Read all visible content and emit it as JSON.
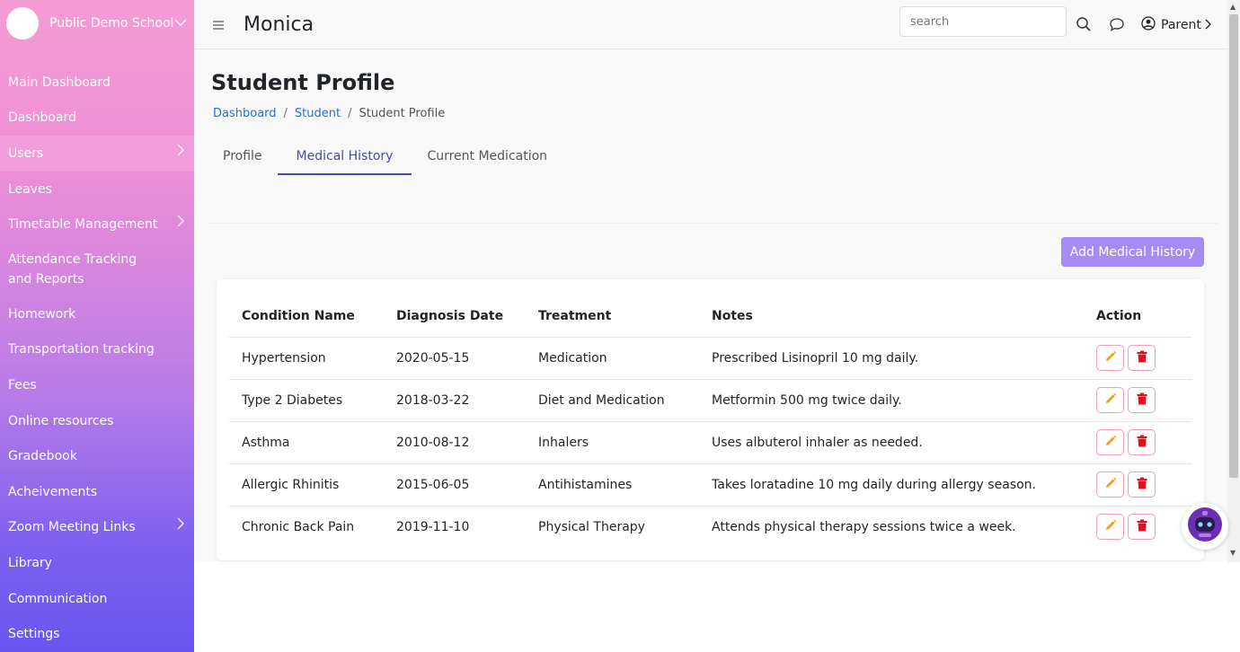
{
  "sidebar": {
    "school": "Public Demo School",
    "items": [
      {
        "label": "Main Dashboard"
      },
      {
        "label": "Dashboard"
      },
      {
        "label": "Users"
      },
      {
        "label": "Leaves"
      },
      {
        "label": "Timetable Management"
      },
      {
        "label": "Attendance Tracking and Reports"
      },
      {
        "label": "Homework"
      },
      {
        "label": "Transportation tracking"
      },
      {
        "label": "Fees"
      },
      {
        "label": "Online resources"
      },
      {
        "label": "Gradebook"
      },
      {
        "label": "Acheivements"
      },
      {
        "label": "Zoom Meeting Links"
      },
      {
        "label": "Library"
      },
      {
        "label": "Communication"
      },
      {
        "label": "Settings"
      }
    ]
  },
  "header": {
    "title": "Monica",
    "search_placeholder": "search",
    "user_label": "Parent"
  },
  "page": {
    "title": "Student Profile",
    "breadcrumb": [
      "Dashboard",
      "Student",
      "Student Profile"
    ],
    "tabs": [
      "Profile",
      "Medical History",
      "Current Medication"
    ],
    "active_tab": "Medical History",
    "add_button": "Add Medical History"
  },
  "table": {
    "headers": [
      "Condition Name",
      "Diagnosis Date",
      "Treatment",
      "Notes",
      "Action"
    ],
    "rows": [
      [
        "Hypertension",
        "2020-05-15",
        "Medication",
        "Prescribed Lisinopril 10 mg daily."
      ],
      [
        "Type 2 Diabetes",
        "2018-03-22",
        "Diet and Medication",
        "Metformin 500 mg twice daily."
      ],
      [
        "Asthma",
        "2010-08-12",
        "Inhalers",
        "Uses albuterol inhaler as needed."
      ],
      [
        "Allergic Rhinitis",
        "2015-06-05",
        "Antihistamines",
        "Takes loratadine 10 mg daily during allergy season."
      ],
      [
        "Chronic Back Pain",
        "2019-11-10",
        "Physical Therapy",
        "Attends physical therapy sessions twice a week."
      ]
    ]
  },
  "colors": {
    "accent": "#4a4ab0",
    "button": "#a78bf4",
    "edit_icon": "#f0a020",
    "delete_icon": "#e01020",
    "link": "#1a73e8"
  },
  "icons": [
    "menu-icon",
    "search-icon",
    "chat-icon",
    "user-circle-icon",
    "chevron-right-icon",
    "chevron-down-icon",
    "pencil-icon",
    "trash-icon",
    "robot-icon"
  ]
}
